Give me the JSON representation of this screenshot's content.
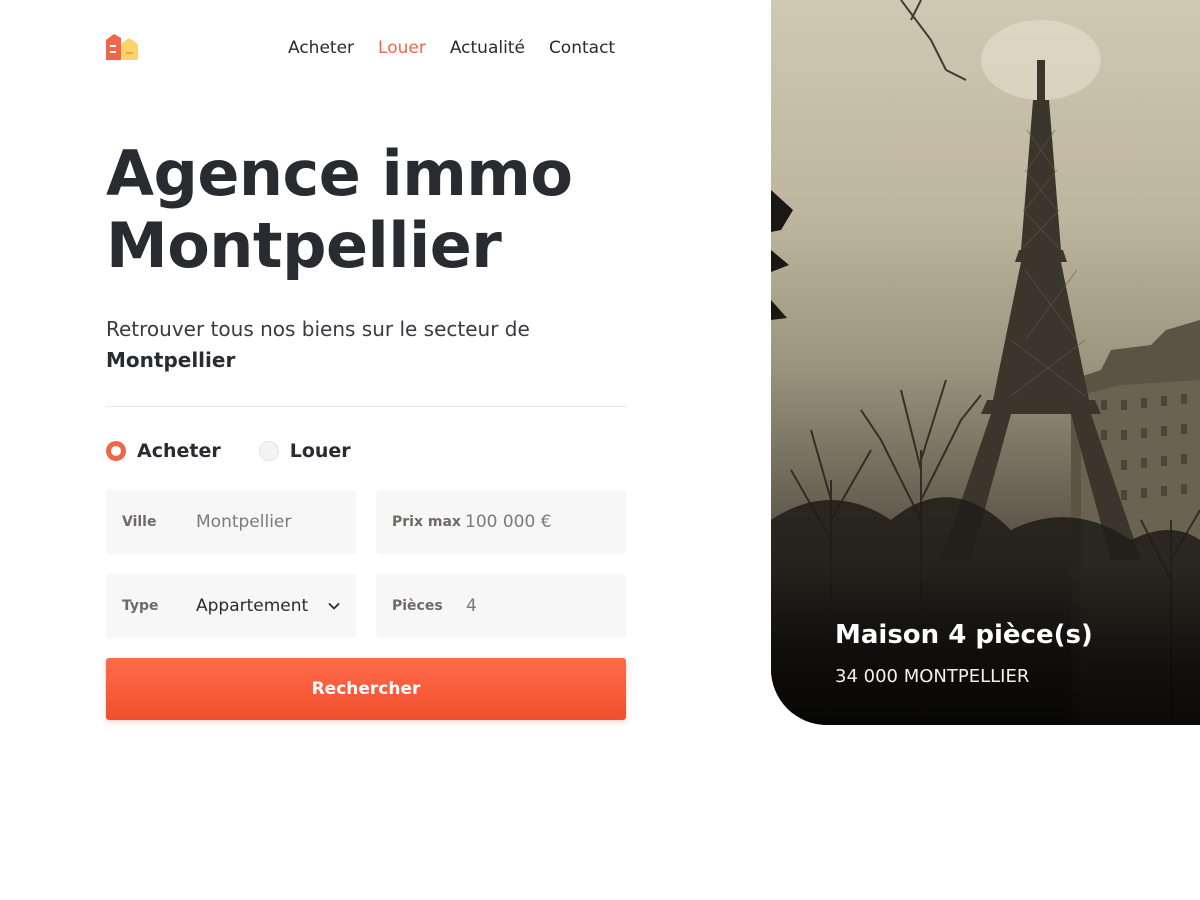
{
  "nav": {
    "items": [
      {
        "label": "Acheter"
      },
      {
        "label": "Louer"
      },
      {
        "label": "Actualité"
      },
      {
        "label": "Contact"
      }
    ],
    "active": "Louer"
  },
  "hero_text": {
    "title_line1": "Agence immo",
    "title_line2": "Montpellier",
    "subtitle": "Retrouver tous nos biens sur le secteur de",
    "subtitle_strong": "Montpellier"
  },
  "search": {
    "mode_options": [
      {
        "label": "Acheter",
        "selected": true
      },
      {
        "label": "Louer",
        "selected": false
      }
    ],
    "ville": {
      "label": "Ville",
      "value": "Montpellier"
    },
    "prix": {
      "label": "Prix max",
      "value": "100 000 €"
    },
    "type": {
      "label": "Type",
      "value": "Appartement"
    },
    "pieces": {
      "label": "Pièces",
      "value": "4"
    },
    "submit_label": "Rechercher"
  },
  "featured": {
    "title": "Maison 4 pièce(s)",
    "location": "34 000 MONTPELLIER",
    "image": "eiffel-tower-photo"
  },
  "colors": {
    "accent": "#f0664b",
    "text": "#2a2b30",
    "field_bg": "#f7f7f7"
  }
}
